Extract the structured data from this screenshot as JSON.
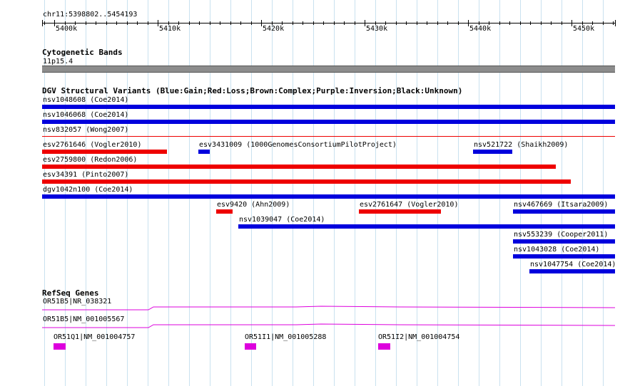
{
  "browser": {
    "locus": "chr11:5398802..5454193",
    "region": {
      "start": 5398802,
      "end": 5454193
    },
    "ruler_ticks": [
      {
        "pos": 5400000,
        "label": "5400k"
      },
      {
        "pos": 5410000,
        "label": "5410k"
      },
      {
        "pos": 5420000,
        "label": "5420k"
      },
      {
        "pos": 5430000,
        "label": "5430k"
      },
      {
        "pos": 5440000,
        "label": "5440k"
      },
      {
        "pos": 5450000,
        "label": "5450k"
      }
    ]
  },
  "cytobands": {
    "title": "Cytogenetic Bands",
    "band_label": "11p15.4",
    "band_color": "#8c8c8c"
  },
  "dgv": {
    "title": "DGV Structural Variants (Blue:Gain;Red:Loss;Brown:Complex;Purple:Inversion;Black:Unknown)",
    "colors": {
      "gain": "#0000dd",
      "loss": "#ee0000"
    },
    "features": [
      {
        "label": "nsv1048608 (Coe2014)",
        "type": "gain",
        "row": 0,
        "start": 5398802,
        "end": 5454193,
        "style": "bar"
      },
      {
        "label": "nsv1046068 (Coe2014)",
        "type": "gain",
        "row": 1,
        "start": 5398802,
        "end": 5454193,
        "style": "bar"
      },
      {
        "label": "nsv832057 (Wong2007)",
        "type": "loss",
        "row": 2,
        "start": 5398802,
        "end": 5454193,
        "style": "line"
      },
      {
        "label": "esv2761646 (Vogler2010)",
        "type": "loss",
        "row": 3,
        "start": 5398802,
        "end": 5410900,
        "style": "bar"
      },
      {
        "label": "esv3431009 (1000GenomesConsortiumPilotProject)",
        "type": "gain",
        "row": 3,
        "start": 5413900,
        "end": 5415000,
        "style": "bar"
      },
      {
        "label": "nsv521722 (Shaikh2009)",
        "type": "gain",
        "row": 3,
        "start": 5440500,
        "end": 5444300,
        "style": "bar"
      },
      {
        "label": "esv2759800 (Redon2006)",
        "type": "loss",
        "row": 4,
        "start": 5398802,
        "end": 5448500,
        "style": "bar"
      },
      {
        "label": "esv34391 (Pinto2007)",
        "type": "loss",
        "row": 5,
        "start": 5398802,
        "end": 5449900,
        "style": "bar"
      },
      {
        "label": "dgv1042n100 (Coe2014)",
        "type": "gain",
        "row": 6,
        "start": 5398802,
        "end": 5454193,
        "style": "bar"
      },
      {
        "label": "esv9420 (Ahn2009)",
        "type": "loss",
        "row": 7,
        "start": 5415600,
        "end": 5417200,
        "style": "bar"
      },
      {
        "label": "esv2761647 (Vogler2010)",
        "type": "loss",
        "row": 7,
        "start": 5429400,
        "end": 5437300,
        "style": "bar"
      },
      {
        "label": "nsv467669 (Itsara2009)",
        "type": "gain",
        "row": 7,
        "start": 5444300,
        "end": 5454193,
        "style": "bar"
      },
      {
        "label": "nsv1039047 (Coe2014)",
        "type": "gain",
        "row": 8,
        "start": 5417800,
        "end": 5454193,
        "style": "bar"
      },
      {
        "label": "nsv553239 (Cooper2011)",
        "type": "gain",
        "row": 9,
        "start": 5444300,
        "end": 5454193,
        "style": "bar"
      },
      {
        "label": "nsv1043028 (Coe2014)",
        "type": "gain",
        "row": 10,
        "start": 5444300,
        "end": 5454193,
        "style": "bar"
      },
      {
        "label": "nsv1047754 (Coe2014)",
        "type": "gain",
        "row": 11,
        "start": 5445900,
        "end": 5454193,
        "style": "bar"
      }
    ]
  },
  "refseq": {
    "title": "RefSeq Genes",
    "color": "#dd00dd",
    "genes": [
      {
        "label": "OR51B5|NR_038321",
        "type": "transcript",
        "start": 5398802,
        "end": 5454193
      },
      {
        "label": "OR51B5|NM_001005567",
        "type": "transcript",
        "start": 5398802,
        "end": 5454193
      },
      {
        "label": "OR51Q1|NM_001004757",
        "type": "exon",
        "start": 5399900,
        "end": 5401100
      },
      {
        "label": "OR51I1|NM_001005288",
        "type": "exon",
        "start": 5418400,
        "end": 5419500
      },
      {
        "label": "OR51I2|NM_001004754",
        "type": "exon",
        "start": 5431300,
        "end": 5432500
      }
    ]
  }
}
